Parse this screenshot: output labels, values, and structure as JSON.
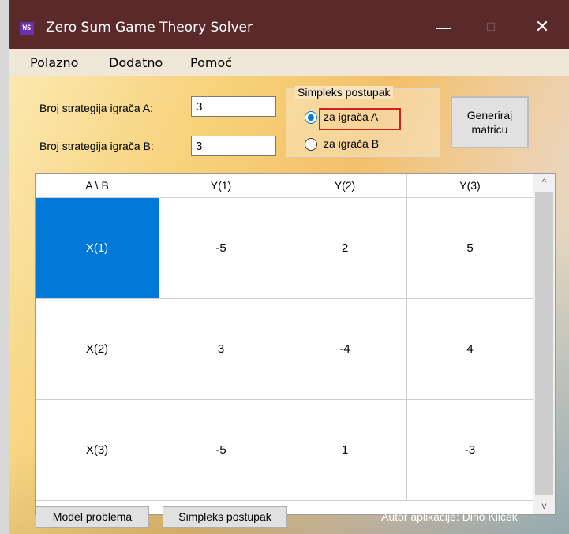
{
  "window": {
    "icon_text": "WS",
    "title": "Zero Sum Game Theory Solver",
    "controls": {
      "minimize": "—",
      "maximize": "☐",
      "close": "✕"
    }
  },
  "menu": [
    "Polazno",
    "Dodatno",
    "Pomoć"
  ],
  "form": {
    "label_a": "Broj strategija igrača A:",
    "value_a": "3",
    "label_b": "Broj strategija igrača B:",
    "value_b": "3",
    "group_title": "Simpleks postupak",
    "radio_a": "za igrača A",
    "radio_b": "za igrača B",
    "selected_radio": "za igrača A",
    "generate_button": "Generiraj matricu"
  },
  "matrix": {
    "headers": [
      "A \\ B",
      "Y(1)",
      "Y(2)",
      "Y(3)"
    ],
    "rows": [
      {
        "label": "X(1)",
        "values": [
          "-5",
          "2",
          "5"
        ]
      },
      {
        "label": "X(2)",
        "values": [
          "3",
          "-4",
          "4"
        ]
      },
      {
        "label": "X(3)",
        "values": [
          "-5",
          "1",
          "-3"
        ]
      }
    ],
    "selected_cell": "X(1)",
    "scroll_up": "^",
    "scroll_down": "v"
  },
  "footer": {
    "model_button": "Model problema",
    "simplex_button": "Simpleks postupak",
    "author": "Autor aplikacije: Dino Kliček"
  },
  "colors": {
    "titlebar": "#5a2a2a",
    "selection": "#0078d7",
    "highlight_border": "#d21f1f"
  }
}
